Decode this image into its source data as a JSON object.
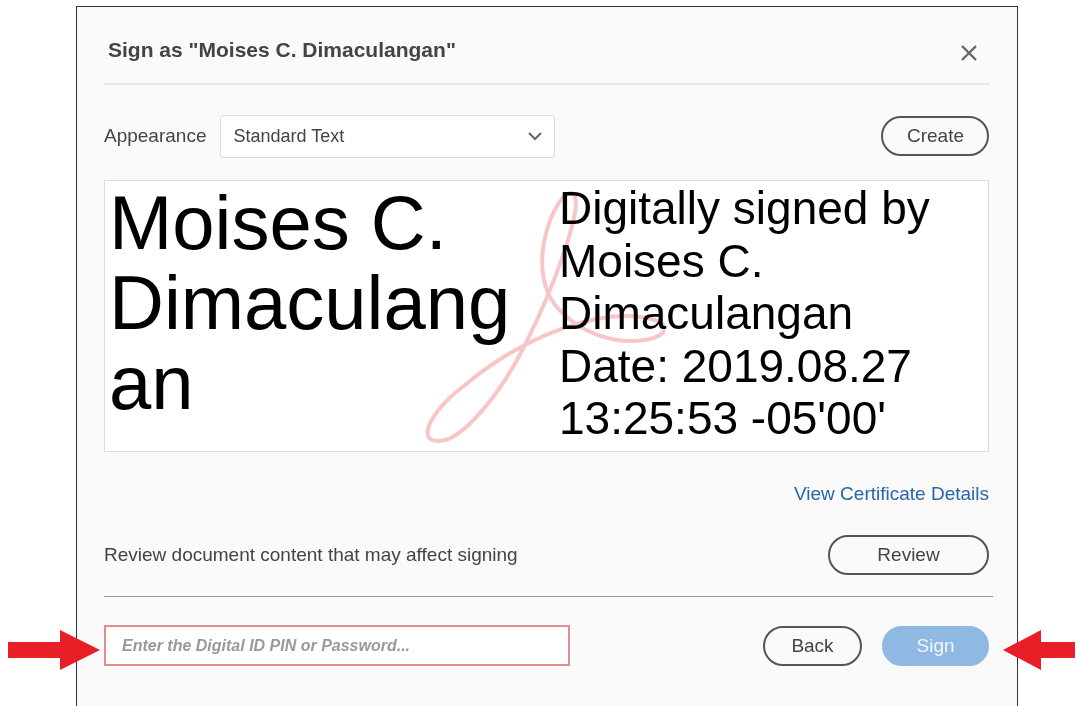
{
  "dialog": {
    "title": "Sign as \"Moises C. Dimaculangan\"",
    "appearance": {
      "label": "Appearance",
      "value": "Standard Text",
      "create_button": "Create"
    },
    "preview": {
      "name": "Moises C. Dimaculangan",
      "details": [
        "Digitally signed by",
        "Moises C.",
        "Dimaculangan",
        "Date: 2019.08.27",
        "13:25:53 -05'00'"
      ]
    },
    "certificate_link": "View Certificate Details",
    "review": {
      "text": "Review document content that may affect signing",
      "button": "Review"
    },
    "password": {
      "placeholder": "Enter the Digital ID PIN or Password...",
      "highlighted": true
    },
    "buttons": [
      {
        "label": "Back",
        "kind": "secondary",
        "disabled": false
      },
      {
        "label": "Sign",
        "kind": "primary",
        "disabled": true
      }
    ]
  },
  "arrows": [
    {
      "kind": "rightward"
    },
    {
      "kind": "leftward"
    }
  ]
}
